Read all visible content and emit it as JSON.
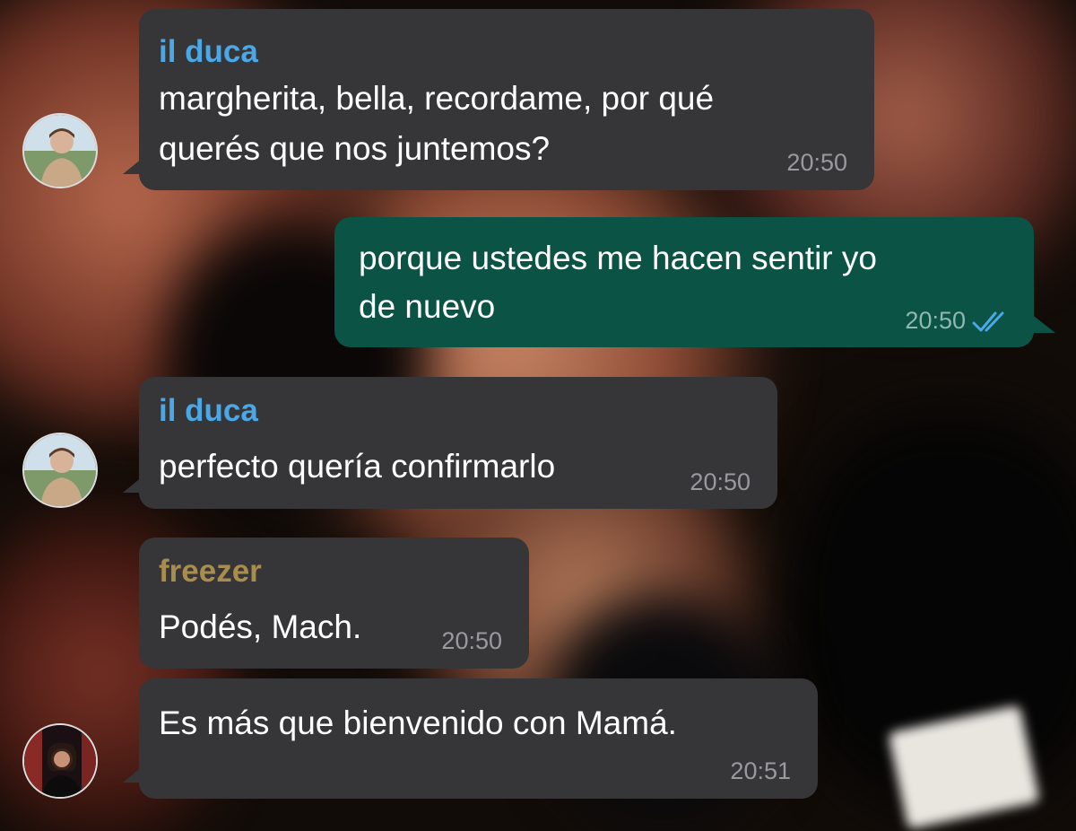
{
  "chat": {
    "messages": [
      {
        "sender": "il duca",
        "sender_color": "#4aa8e6",
        "lines": [
          "margherita, bella, recordame, por qué",
          "querés que nos juntemos?"
        ],
        "time": "20:50"
      },
      {
        "direction": "outgoing",
        "lines": [
          "porque ustedes me hacen sentir yo",
          "de nuevo"
        ],
        "time": "20:50",
        "read_receipt": "double-check-icon"
      },
      {
        "sender": "il duca",
        "sender_color": "#4aa8e6",
        "lines": [
          "perfecto quería confirmarlo"
        ],
        "time": "20:50"
      },
      {
        "sender": "freezer",
        "sender_color": "#a98d4e",
        "lines": [
          "Podés, Mach."
        ],
        "time": "20:50"
      },
      {
        "lines": [
          "Es más que bienvenido con Mamá."
        ],
        "time": "20:51"
      }
    ]
  },
  "colors": {
    "incoming_bubble": "#363638",
    "outgoing_bubble": "#0b5345",
    "read_ticks": "#4aa8e6"
  }
}
